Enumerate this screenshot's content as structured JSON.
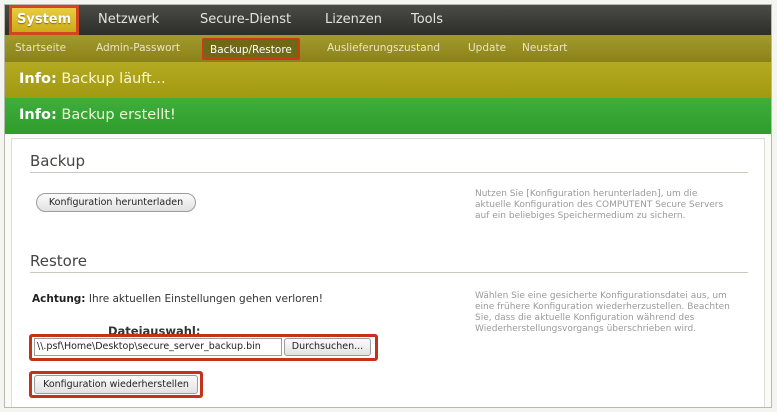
{
  "topnav": {
    "items": [
      "System",
      "Netzwerk",
      "Secure-Dienst",
      "Lizenzen",
      "Tools"
    ]
  },
  "subnav": {
    "items": [
      "Startseite",
      "Admin-Passwort",
      "Backup/Restore",
      "Auslieferungszustand",
      "Update",
      "Neustart"
    ]
  },
  "info": {
    "prefix": "Info:",
    "backup_running": "Backup läuft...",
    "backup_created": "Backup erstellt!"
  },
  "backup": {
    "title": "Backup",
    "download_button": "Konfiguration herunterladen",
    "help": "Nutzen Sie [Konfiguration herunterladen], um die aktuelle Konfiguration des COMPUTENT Secure Servers auf ein beliebiges Speichermedium zu sichern."
  },
  "restore": {
    "title": "Restore",
    "warning_label": "Achtung:",
    "warning_text": "Ihre aktuellen Einstellungen gehen verloren!",
    "file_label": "Dateiauswahl:",
    "file_value": "\\\\.psf\\Home\\Desktop\\secure_server_backup.bin",
    "browse_button": "Durchsuchen...",
    "restore_button": "Konfiguration wiederherstellen",
    "help": "Wählen Sie eine gesicherte Konfigurationsdatei aus, um eine frühere Konfiguration wiederherzustellen. Beachten Sie, dass die aktuelle Konfiguration während des Wiederherstellungsvorgangs überschrieben wird."
  },
  "colors": {
    "highlight_border": "#c4321a",
    "topnav_active": "#d9bb2a",
    "info_yellow": "#a89f18",
    "info_green": "#36a433"
  }
}
